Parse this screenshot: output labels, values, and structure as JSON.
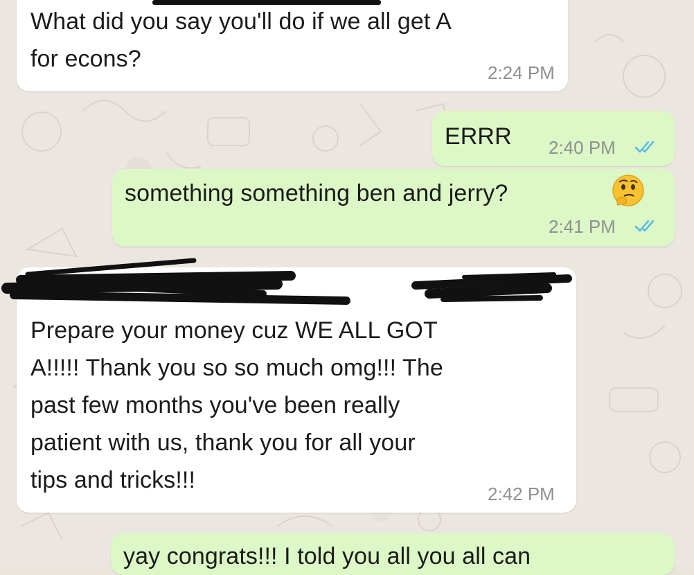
{
  "messages": [
    {
      "direction": "incoming",
      "lines": [
        "What did you say you'll do if we all get A",
        "for econs?"
      ],
      "time": "2:24 PM"
    },
    {
      "direction": "outgoing",
      "lines": [
        "ERRR"
      ],
      "time": "2:40 PM",
      "read_receipt": "double-check-icon"
    },
    {
      "direction": "outgoing",
      "lines": [
        "something something ben and jerry?"
      ],
      "emoji": "thinking-face-icon",
      "time": "2:41 PM",
      "read_receipt": "double-check-icon"
    },
    {
      "direction": "incoming",
      "sender_redacted": true,
      "lines": [
        "Prepare your money cuz WE ALL GOT",
        "A!!!!! Thank you so so much omg!!! The",
        "past few months you've been really",
        "patient with us, thank you for all your",
        "tips and tricks!!!"
      ],
      "time": "2:42 PM"
    },
    {
      "direction": "outgoing",
      "lines": [
        "yay congrats!!! I told you all you all can"
      ]
    }
  ],
  "colors": {
    "incoming_bubble": "#ffffff",
    "outgoing_bubble": "#dcf8c6",
    "read_tick": "#4fb6ec",
    "timestamp": "#8d9091",
    "wallpaper": "#ebe6df"
  }
}
